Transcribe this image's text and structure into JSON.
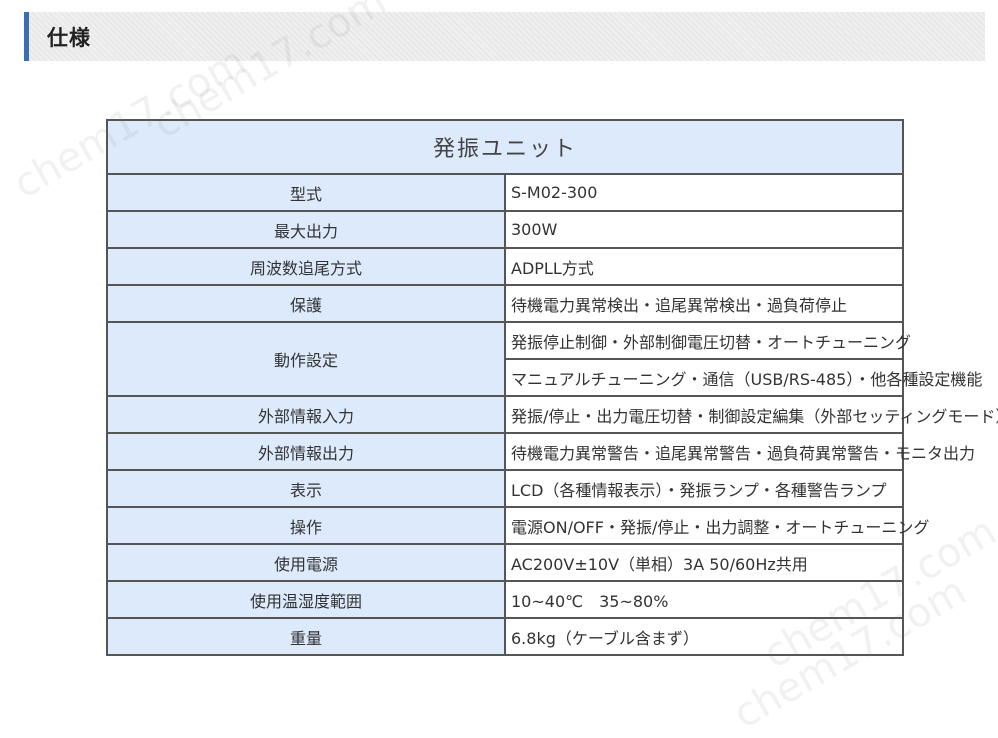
{
  "section": {
    "title": "仕様"
  },
  "table": {
    "caption": "発振ユニット",
    "rows": [
      {
        "label": "型式",
        "values": [
          "S-M02-300"
        ]
      },
      {
        "label": "最大出力",
        "values": [
          "300W"
        ]
      },
      {
        "label": "周波数追尾方式",
        "values": [
          "ADPLL方式"
        ]
      },
      {
        "label": "保護",
        "values": [
          "待機電力異常検出・追尾異常検出・過負荷停止"
        ]
      },
      {
        "label": "動作設定",
        "values": [
          "発振停止制御・外部制御電圧切替・オートチューニング",
          "マニュアルチューニング・通信（USB/RS-485）・他各種設定機能"
        ]
      },
      {
        "label": "外部情報入力",
        "values": [
          "発振/停止・出力電圧切替・制御設定編集（外部セッティングモード）"
        ]
      },
      {
        "label": "外部情報出力",
        "values": [
          "待機電力異常警告・追尾異常警告・過負荷異常警告・モニタ出力"
        ]
      },
      {
        "label": "表示",
        "values": [
          "LCD（各種情報表示）・発振ランプ・各種警告ランプ"
        ]
      },
      {
        "label": "操作",
        "values": [
          "電源ON/OFF・発振/停止・出力調整・オートチューニング"
        ]
      },
      {
        "label": "使用電源",
        "values": [
          "AC200V±10V（単相）3A 50/60Hz共用"
        ]
      },
      {
        "label": "使用温湿度範囲",
        "values": [
          "10~40℃　35~80%"
        ]
      },
      {
        "label": "重量",
        "values": [
          "6.8kg（ケーブル含まず）"
        ]
      }
    ]
  },
  "watermark": "chem17.com"
}
